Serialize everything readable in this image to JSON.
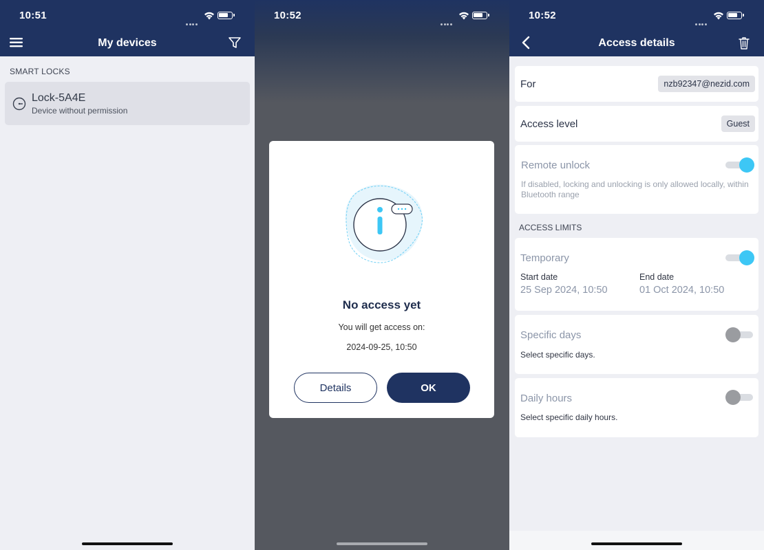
{
  "screens": {
    "my_devices": {
      "status_time": "10:51",
      "title": "My devices",
      "menu_icon": "hamburger-menu-icon",
      "filter_icon": "filter-icon",
      "section_label": "SMART LOCKS",
      "lock": {
        "name": "Lock-5A4E",
        "subtitle": "Device without permission",
        "icon": "lock-dial-icon"
      }
    },
    "no_access": {
      "status_time": "10:52",
      "dialog": {
        "illustration": "info-illustration-icon",
        "title": "No access yet",
        "message": "You will get access on:",
        "date": "2024-09-25, 10:50",
        "details_label": "Details",
        "ok_label": "OK"
      }
    },
    "access_details": {
      "status_time": "10:52",
      "title": "Access details",
      "back_icon": "chevron-left-icon",
      "delete_icon": "trash-icon",
      "for_label": "For",
      "for_value": "nzb92347@nezid.com",
      "access_level_label": "Access level",
      "access_level_value": "Guest",
      "remote_unlock": {
        "label": "Remote unlock",
        "description": "If disabled, locking and unlocking is only allowed locally, within Bluetooth range",
        "enabled": true
      },
      "limits_label": "ACCESS LIMITS",
      "temporary": {
        "label": "Temporary",
        "enabled": true,
        "start_label": "Start date",
        "start_value": "25 Sep 2024, 10:50",
        "end_label": "End date",
        "end_value": "01 Oct 2024, 10:50"
      },
      "specific_days": {
        "label": "Specific days",
        "description": "Select specific days.",
        "enabled": false
      },
      "daily_hours": {
        "label": "Daily hours",
        "description": "Select specific daily hours.",
        "enabled": false
      }
    }
  },
  "colors": {
    "header": "#1f3361",
    "accent": "#3dc7f5",
    "background": "#eeeff4"
  }
}
